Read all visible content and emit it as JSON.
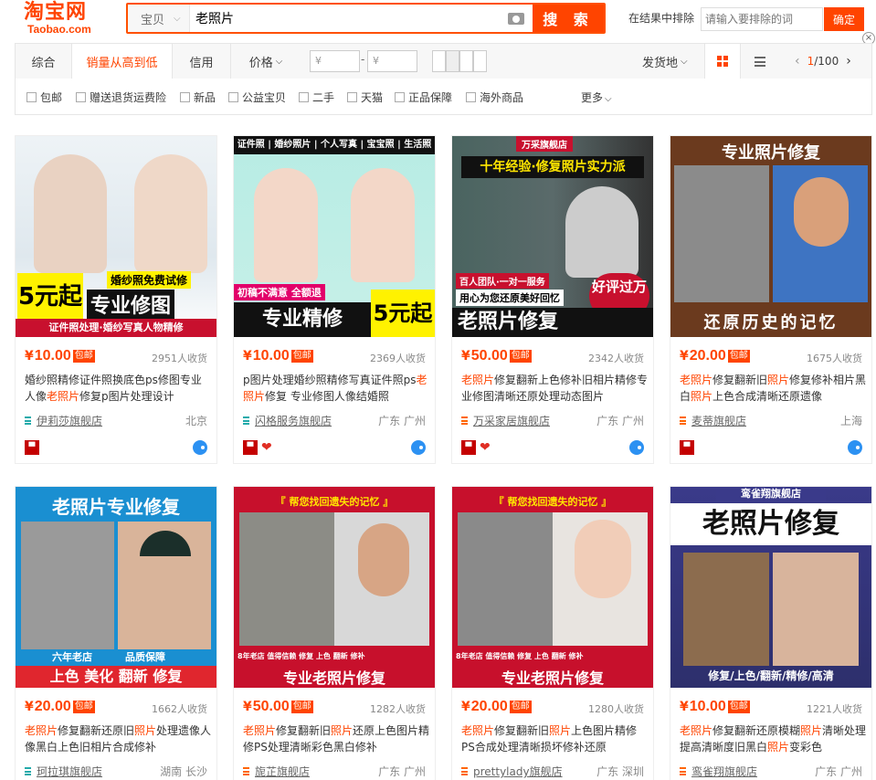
{
  "header": {
    "logo_cn": "淘宝网",
    "logo_en": "Taobao.com",
    "search_type": "宝贝",
    "search_value": "老照片",
    "search_button": "搜 索",
    "exclude_label": "在结果中排除",
    "exclude_placeholder": "请输入要排除的词",
    "confirm_button": "确定"
  },
  "sortbar": {
    "tabs": [
      "综合",
      "销量从高到低",
      "信用",
      "价格"
    ],
    "price_min_placeholder": "¥",
    "price_max_placeholder": "¥",
    "price_dash": "-",
    "ship_from": "发货地",
    "page_current": "1",
    "page_total": "/100"
  },
  "filters": {
    "items": [
      "包邮",
      "赠送退货运费险",
      "新品",
      "公益宝贝",
      "二手",
      "天猫",
      "正品保障",
      "海外商品"
    ],
    "more": "更多"
  },
  "colors": {
    "accent": "#ff4400"
  },
  "products": [
    {
      "price": "10.00",
      "sold": "2951人收货",
      "shipping": "包邮",
      "title_parts": [
        [
          "t",
          "婚纱照精修证件照换底色ps修图专业人像"
        ],
        [
          "h",
          "老照片"
        ],
        [
          "t",
          "修复p图片处理设计"
        ]
      ],
      "shop": "伊莉莎旗舰店",
      "location": "北京",
      "img_texts": [
        "婚纱照免费试修",
        "5元起",
        "专业修图",
        "证件照处理·婚纱写真人物精修"
      ]
    },
    {
      "price": "10.00",
      "sold": "2369人收货",
      "shipping": "包邮",
      "title_parts": [
        [
          "t",
          "p图片处理婚纱照精修写真证件照ps"
        ],
        [
          "h",
          "老照片"
        ],
        [
          "t",
          "修复 专业修图人像结婚照"
        ]
      ],
      "shop": "闪格服务旗舰店",
      "location": "广东 广州",
      "img_texts": [
        "证件照 | 婚纱照片 | 个人写真 | 宝宝照 | 生活照",
        "初稿不满意 全额退",
        "专业精修",
        "5元起"
      ]
    },
    {
      "price": "50.00",
      "sold": "2342人收货",
      "shipping": "包邮",
      "title_parts": [
        [
          "h",
          "老照片"
        ],
        [
          "t",
          "修复翻新上色修补旧相片精修专业修图清晰还原处理动态图片"
        ]
      ],
      "shop": "万采家居旗舰店",
      "location": "广东 广州",
      "img_texts": [
        "万采旗舰店",
        "十年经验·修复照片实力派",
        "百人团队·一对一服务",
        "用心为您还原美好回忆",
        "好评过万",
        "老照片修复"
      ]
    },
    {
      "price": "20.00",
      "sold": "1675人收货",
      "shipping": "包邮",
      "title_parts": [
        [
          "h",
          "老照片"
        ],
        [
          "t",
          "修复翻新旧"
        ],
        [
          "h",
          "照片"
        ],
        [
          "t",
          "修复修补相片黑白"
        ],
        [
          "h",
          "照片"
        ],
        [
          "t",
          "上色合成清晰还原遗像"
        ]
      ],
      "shop": "麦蒂旗舰店",
      "location": "上海",
      "img_texts": [
        "专业照片修复",
        "还原历史的记忆"
      ]
    },
    {
      "price": "20.00",
      "sold": "1662人收货",
      "shipping": "包邮",
      "title_parts": [
        [
          "h",
          "老照片"
        ],
        [
          "t",
          "修复翻新还原旧"
        ],
        [
          "h",
          "照片"
        ],
        [
          "t",
          "处理遗像人像黑白上色旧相片合成修补"
        ]
      ],
      "shop": "珂拉琪旗舰店",
      "location": "湖南 长沙",
      "img_texts": [
        "老照片专业修复",
        "六年老店",
        "品质保障",
        "上色 美化 翻新 修复"
      ]
    },
    {
      "price": "50.00",
      "sold": "1282人收货",
      "shipping": "包邮",
      "title_parts": [
        [
          "h",
          "老照片"
        ],
        [
          "t",
          "修复翻新旧"
        ],
        [
          "h",
          "照片"
        ],
        [
          "t",
          "还原上色图片精修PS处理清晰彩色黑白修补"
        ]
      ],
      "shop": "旎芷旗舰店",
      "location": "广东 广州",
      "img_texts": [
        "『 帮您找回遗失的记忆 』",
        "8年老店 值得信赖 修复 上色 翻新 修补",
        "专业老照片修复"
      ]
    },
    {
      "price": "20.00",
      "sold": "1280人收货",
      "shipping": "包邮",
      "title_parts": [
        [
          "h",
          "老照片"
        ],
        [
          "t",
          "修复翻新旧"
        ],
        [
          "h",
          "照片"
        ],
        [
          "t",
          "上色图片精修PS合成处理清晰损坏修补还原"
        ]
      ],
      "shop": "prettylady旗舰店",
      "location": "广东 深圳",
      "img_texts": [
        "『 帮您找回遗失的记忆 』",
        "8年老店 值得信赖 修复 上色 翻新 修补",
        "专业老照片修复"
      ]
    },
    {
      "price": "10.00",
      "sold": "1221人收货",
      "shipping": "包邮",
      "title_parts": [
        [
          "h",
          "老照片"
        ],
        [
          "t",
          "修复翻新还原模糊"
        ],
        [
          "h",
          "照片"
        ],
        [
          "t",
          "清晰处理提高清晰度旧黑白"
        ],
        [
          "h",
          "照片"
        ],
        [
          "t",
          "变彩色"
        ]
      ],
      "shop": "鸾雀翔旗舰店",
      "location": "广东 广州",
      "img_texts": [
        "鸾雀翔旗舰店",
        "老照片修复",
        "修复/上色/翻新/精修/高清"
      ]
    }
  ]
}
